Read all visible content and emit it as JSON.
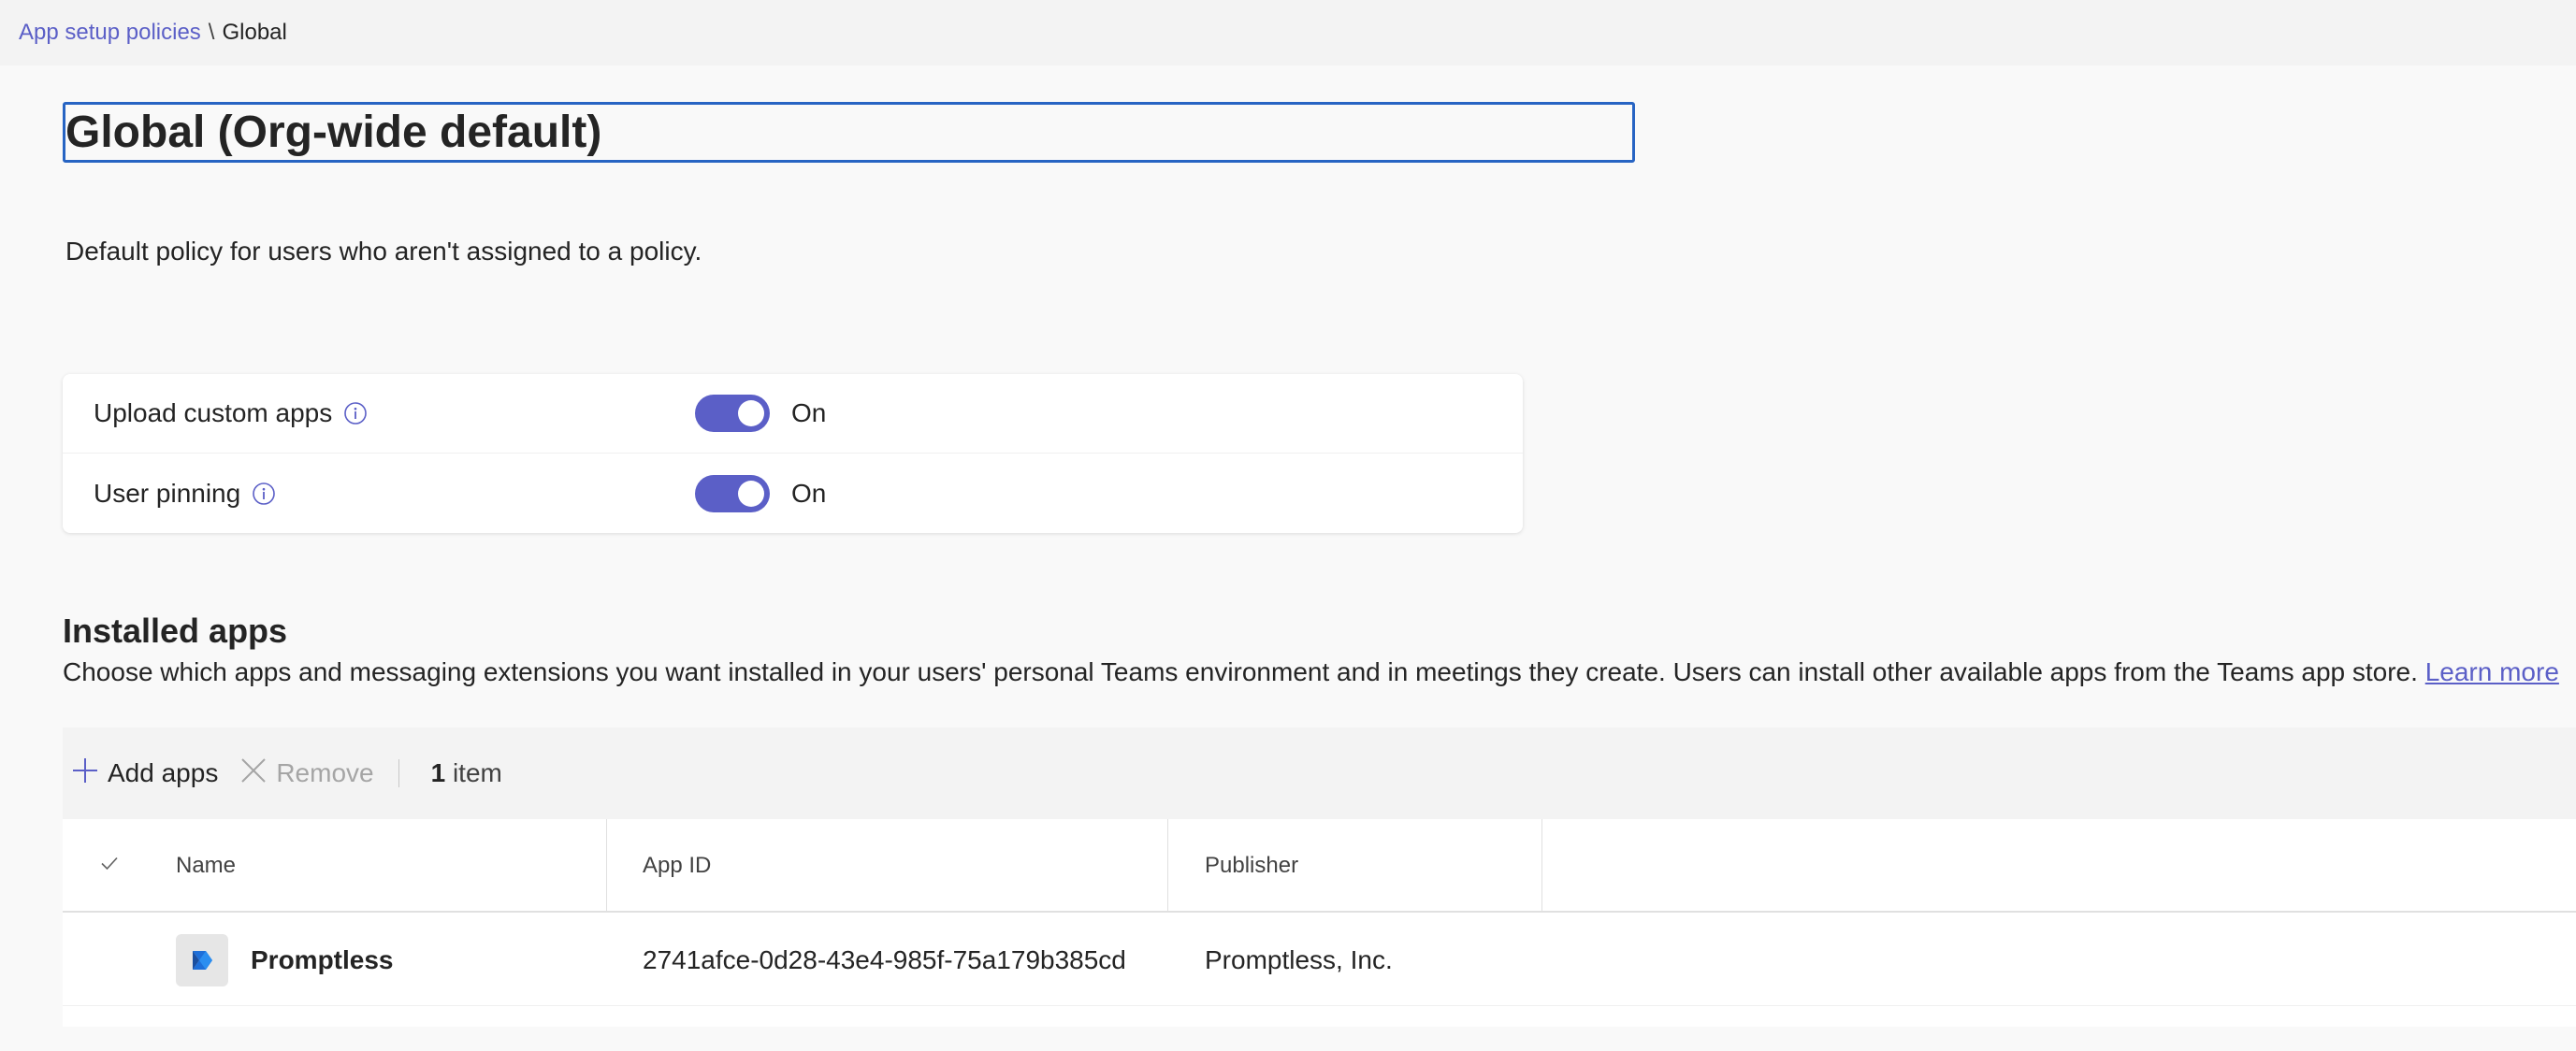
{
  "breadcrumb": {
    "parent": "App setup policies",
    "separator": "\\",
    "current": "Global"
  },
  "policy": {
    "title": "Global (Org-wide default)",
    "description": "Default policy for users who aren't assigned to a policy."
  },
  "settings": [
    {
      "label": "Upload custom apps",
      "state": "On",
      "enabled": true
    },
    {
      "label": "User pinning",
      "state": "On",
      "enabled": true
    }
  ],
  "installed_apps": {
    "title": "Installed apps",
    "description": "Choose which apps and messaging extensions you want installed in your users' personal Teams environment and in meetings they create. Users can install other available apps from the Teams app store.",
    "learn_more": "Learn more"
  },
  "commands": {
    "add_label": "Add apps",
    "remove_label": "Remove",
    "count_number": "1",
    "count_unit": "item"
  },
  "table": {
    "columns": [
      "Name",
      "App ID",
      "Publisher"
    ],
    "rows": [
      {
        "name": "Promptless",
        "app_id": "2741afce-0d28-43e4-985f-75a179b385cd",
        "publisher": "Promptless, Inc."
      }
    ]
  },
  "colors": {
    "accent": "#5b5fc7",
    "focus_border": "#2764c3"
  }
}
